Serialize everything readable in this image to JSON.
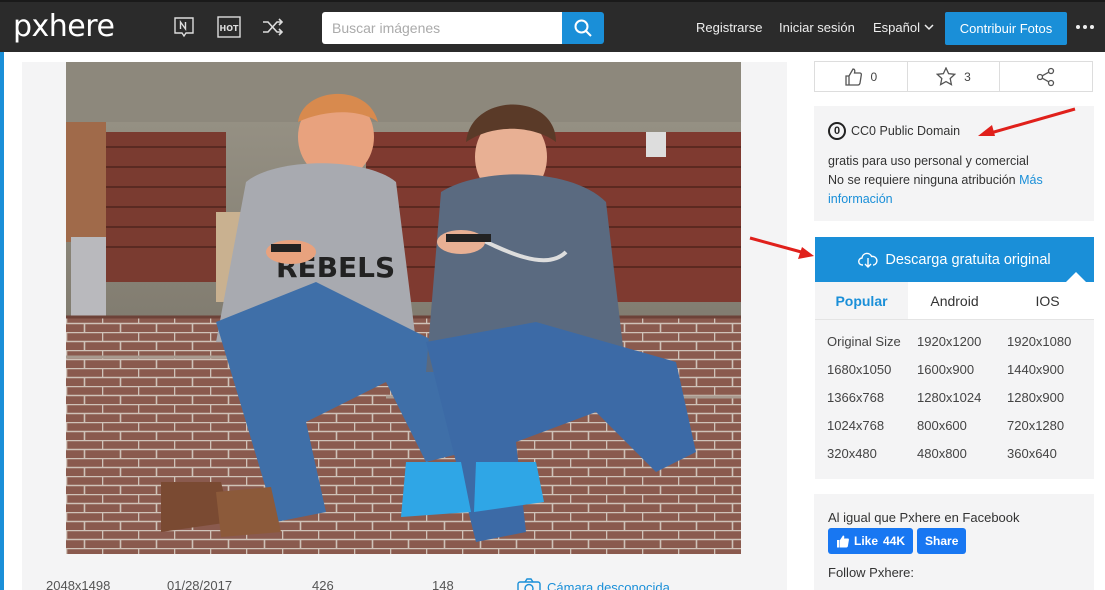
{
  "header": {
    "logo": "pxhere",
    "search_placeholder": "Buscar imágenes",
    "register": "Registrarse",
    "login": "Iniciar sesión",
    "language": "Español",
    "contribute": "Contribuir Fotos",
    "icons": [
      "new-icon",
      "hot-icon",
      "shuffle-icon",
      "search-icon",
      "chevron-down-icon",
      "more-icon"
    ]
  },
  "photo": {
    "description": "two boys sitting on brick steps looking at smartphones"
  },
  "meta": {
    "dimensions": "2048x1498",
    "date": "01/28/2017",
    "views": "426",
    "downloads": "148",
    "camera": "Cámara desconocida"
  },
  "actions": {
    "likes": "0",
    "favorites": "3"
  },
  "license": {
    "title": "CC0 Public Domain",
    "line1": "gratis para uso personal y comercial",
    "line2": "No se requiere ninguna atribución",
    "more": "Más información"
  },
  "download": {
    "button": "Descarga gratuita original",
    "tabs": [
      "Popular",
      "Android",
      "IOS"
    ],
    "active_tab": "Popular",
    "sizes": [
      "Original Size",
      "1920x1200",
      "1920x1080",
      "1680x1050",
      "1600x900",
      "1440x900",
      "1366x768",
      "1280x1024",
      "1280x900",
      "1024x768",
      "800x600",
      "720x1280",
      "320x480",
      "480x800",
      "360x640"
    ]
  },
  "facebook": {
    "title": "Al igual que Pxhere en Facebook",
    "like": "Like",
    "count": "44K",
    "share": "Share",
    "follow": "Follow Pxhere:"
  },
  "colors": {
    "accent": "#1a8fd8",
    "navbar": "#2b2b2b",
    "annotation_arrow": "#e0201b"
  }
}
